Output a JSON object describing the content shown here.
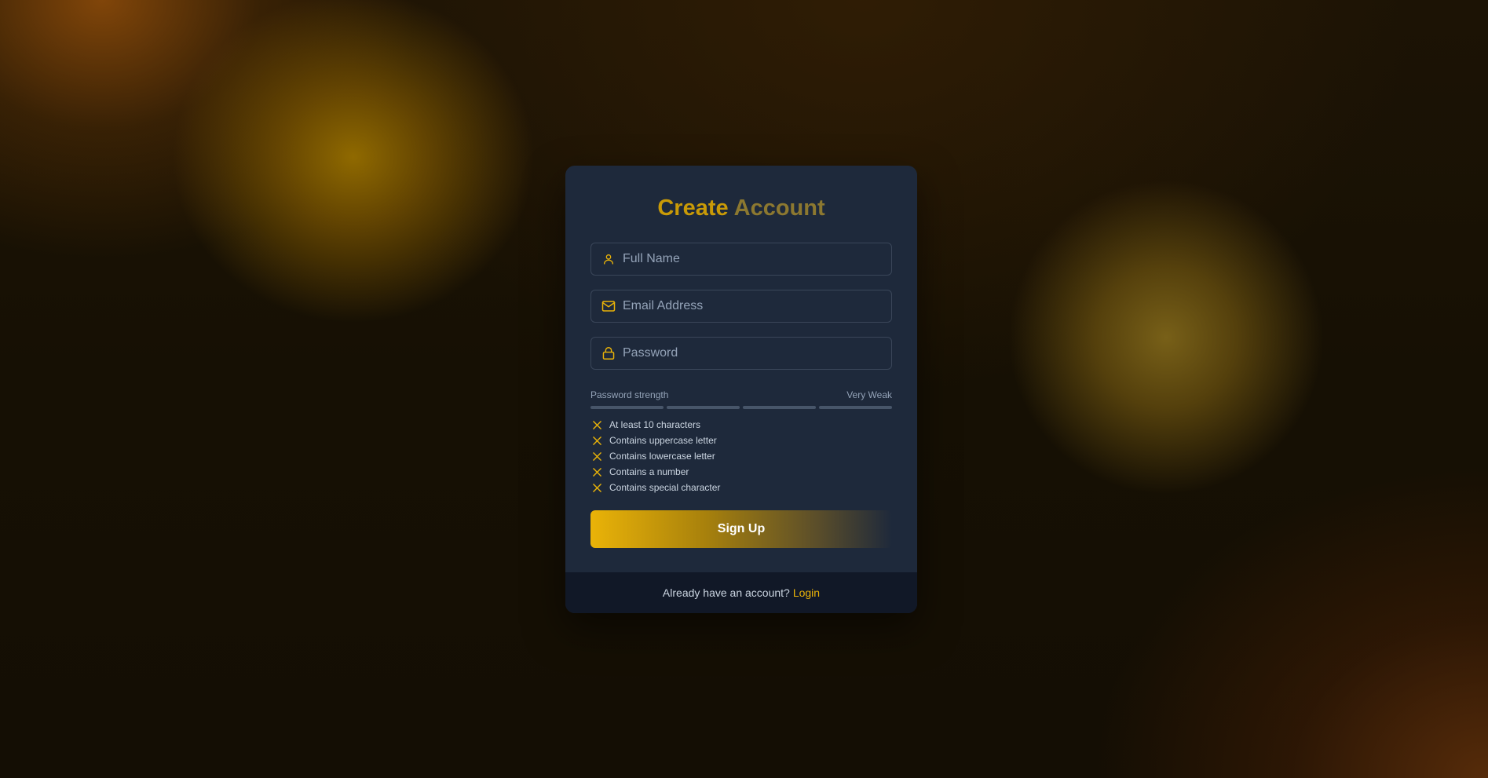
{
  "colors": {
    "accent": "#eab308",
    "card_background": "#1e293b",
    "footer_background": "#111827",
    "invalid_mark": "#eab308"
  },
  "form": {
    "title_word_1": "Create",
    "title_word_2": "Account",
    "fields": [
      {
        "icon": "user-icon",
        "placeholder": "Full Name",
        "value": ""
      },
      {
        "icon": "mail-icon",
        "placeholder": "Email Address",
        "value": ""
      },
      {
        "icon": "lock-icon",
        "placeholder": "Password",
        "value": ""
      }
    ],
    "strength": {
      "label": "Password strength",
      "value_label": "Very Weak",
      "segments_total": 4,
      "segments_filled": 0
    },
    "requirements": [
      {
        "text": "At least 10 characters",
        "met": false,
        "icon": "x-icon"
      },
      {
        "text": "Contains uppercase letter",
        "met": false,
        "icon": "x-icon"
      },
      {
        "text": "Contains lowercase letter",
        "met": false,
        "icon": "x-icon"
      },
      {
        "text": "Contains a number",
        "met": false,
        "icon": "x-icon"
      },
      {
        "text": "Contains special character",
        "met": false,
        "icon": "x-icon"
      }
    ],
    "submit_label": "Sign Up"
  },
  "footer": {
    "prompt": "Already have an account?",
    "link_label": "Login"
  }
}
